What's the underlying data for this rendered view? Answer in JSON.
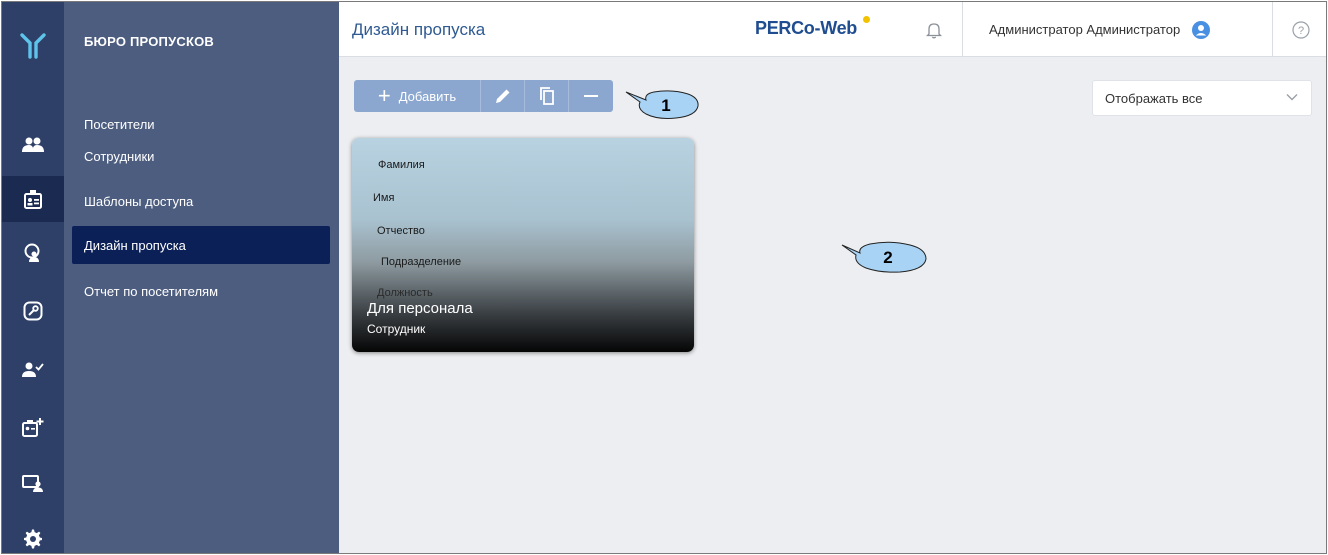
{
  "sidebar": {
    "section_title": "БЮРО ПРОПУСКОВ",
    "items": [
      {
        "label": "Посетители"
      },
      {
        "label": "Сотрудники"
      },
      {
        "label": "Шаблоны доступа"
      },
      {
        "label": "Дизайн пропуска",
        "active": true
      },
      {
        "label": "Отчет по посетителям"
      }
    ],
    "rail_icons": [
      "visitors-icon",
      "badge-icon",
      "location-person-icon",
      "key-icon",
      "person-check-icon",
      "badge-add-icon",
      "monitor-user-icon",
      "gear-icon"
    ],
    "active_rail_icon": "badge-icon"
  },
  "header": {
    "title": "Дизайн пропуска",
    "brand": "PERCo-Web",
    "user_name": "Администратор Администратор",
    "icons": [
      "bell-icon",
      "user-avatar-icon",
      "help-icon"
    ]
  },
  "toolbar": {
    "add_label": "Добавить",
    "icons": [
      "plus-icon",
      "pencil-icon",
      "copy-icon",
      "minus-icon"
    ]
  },
  "filter": {
    "selected": "Отображать все"
  },
  "card": {
    "fields": [
      "Фамилия",
      "Имя",
      "Отчество",
      "Подразделение",
      "Должность"
    ],
    "name": "Для персонала",
    "subtitle": "Сотрудник"
  },
  "callouts": [
    "1",
    "2"
  ],
  "colors": {
    "rail_bg": "#2e4068",
    "menu_bg": "#4d5d80",
    "menu_active": "#0b2057",
    "toolbar_btn": "#8ca7cf",
    "brand": "#1f4d8f",
    "brand_dot": "#f2c200",
    "callout_fill": "#a9d3f5"
  }
}
